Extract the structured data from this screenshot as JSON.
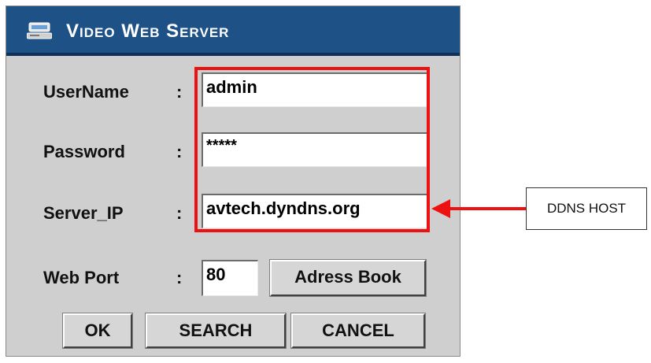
{
  "window": {
    "title": "Video Web Server",
    "title_icon": "server-icon"
  },
  "form": {
    "username": {
      "label": "UserName",
      "colon": ":",
      "value": "admin"
    },
    "password": {
      "label": "Password",
      "colon": ":",
      "value": "*****"
    },
    "server_ip": {
      "label": "Server_IP",
      "colon": ":",
      "value": "avtech.dyndns.org"
    },
    "web_port": {
      "label": "Web Port",
      "colon": ":",
      "value": "80"
    }
  },
  "buttons": {
    "address_book": "Adress Book",
    "ok": "OK",
    "search": "SEARCH",
    "cancel": "CANCEL"
  },
  "annotation": {
    "callout_text": "DDNS HOST",
    "highlight_color": "#ee1111"
  },
  "colors": {
    "titlebar": "#1e5286",
    "window_bg": "#cfcfcf"
  }
}
